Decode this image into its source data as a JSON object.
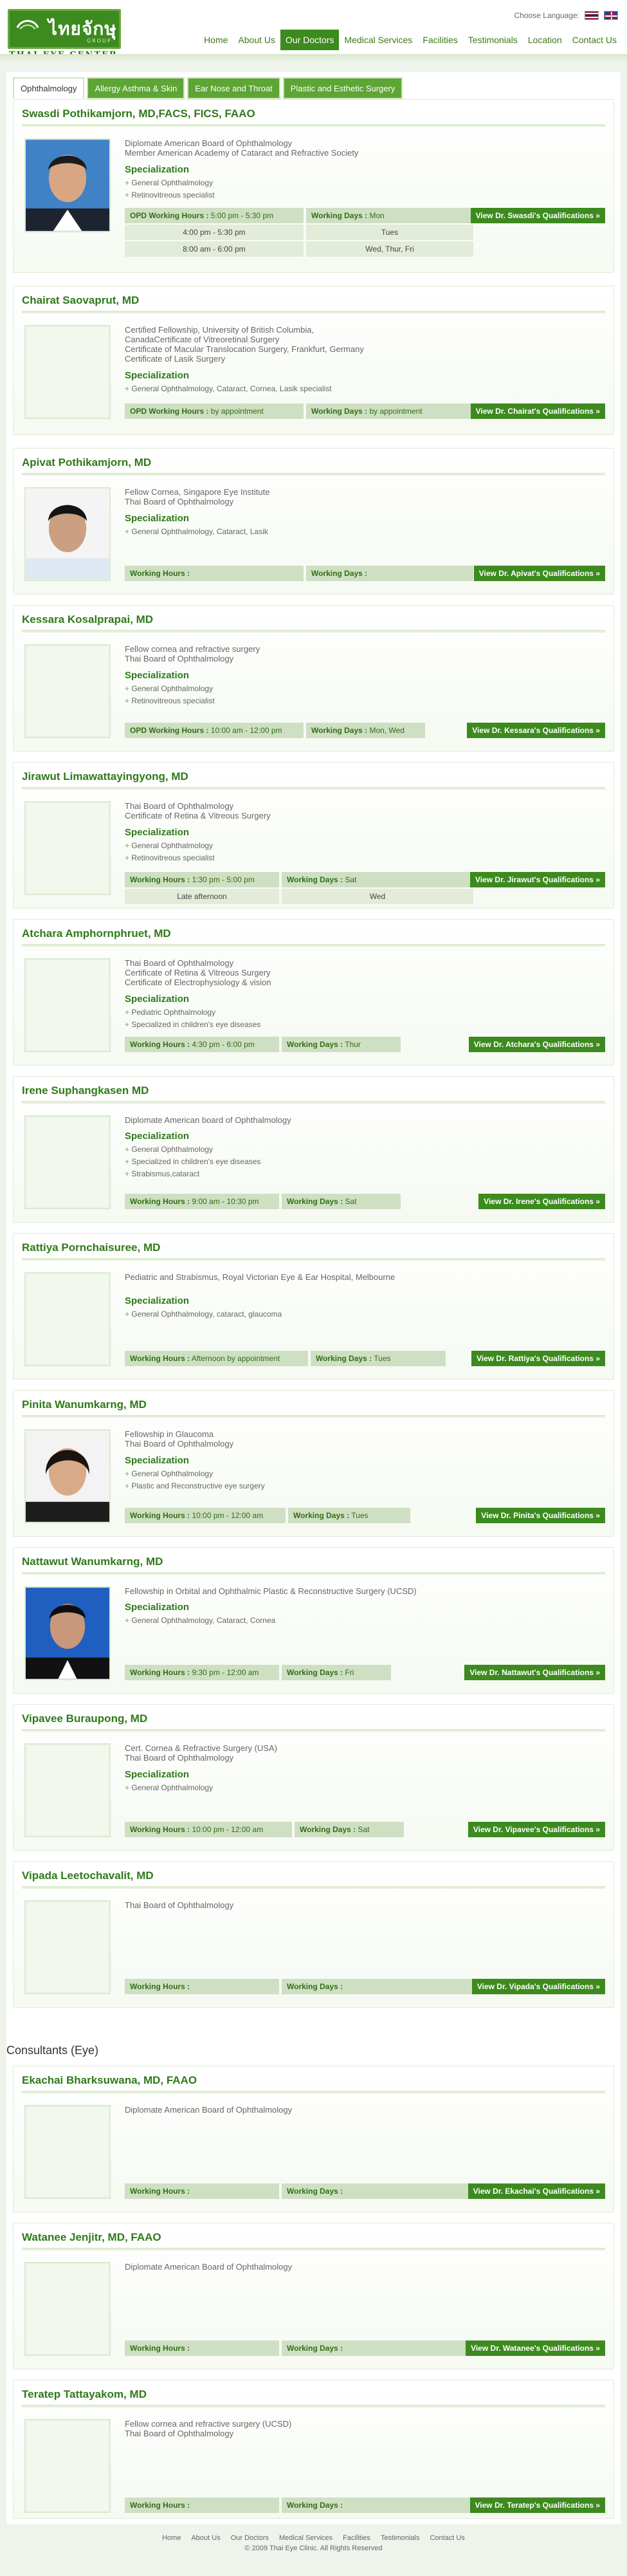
{
  "header": {
    "logo_text": "ไทยจักษุ",
    "logo_sub": "GROUP",
    "logo_caption": "THAI EYE CENTER",
    "choose_language": "Choose Language:",
    "nav": [
      "Home",
      "About Us",
      "Our Doctors",
      "Medical Services",
      "Facilities",
      "Testimonials",
      "Location",
      "Contact Us"
    ]
  },
  "tabs": [
    "Ophthalmology",
    "Allergy Asthma & Skin",
    "Ear Nose and Throat",
    "Plastic and Esthetic Surgery"
  ],
  "doctors": [
    {
      "name": "Swasdi Pothikamjorn, MD,FACS, FICS, FAAO",
      "credentials": [
        "Diplomate American Board of Ophthalmology",
        "Member American Academy of Cataract and Refractive Society"
      ],
      "specialization_label": "Specialization",
      "specializations": [
        "General Ophthalmology",
        "Retinovitreous specialist"
      ],
      "hours_label": "OPD Working Hours :",
      "hours": [
        "5:00 pm - 5:30 pm",
        "4:00 pm - 5:30 pm",
        "8:00 am - 6:00 pm"
      ],
      "days_label": "Working Days :",
      "days": [
        "Mon",
        "Tues",
        "Wed, Thur, Fri"
      ],
      "button": "View Dr. Swasdi's Qualifications »"
    },
    {
      "name": "Chairat Saovaprut, MD",
      "credentials": [
        "Certified Fellowship, University of British Columbia,",
        "CanadaCertificate of Vitreoretinal Surgery",
        "Certificate of Macular Translocation Surgery, Frankfurt, Germany",
        "Certificate of Lasik Surgery"
      ],
      "specialization_label": "Specialization",
      "specializations": [
        "General Ophthalmology, Cataract,  Cornea,  Lasik specialist"
      ],
      "hours_label": "OPD Working Hours :",
      "hours": [
        "by appointment"
      ],
      "days_label": "Working Days :",
      "days": [
        "by appointment"
      ],
      "button": "View Dr. Chairat's Qualifications »"
    },
    {
      "name": "Apivat Pothikamjorn, MD",
      "credentials": [
        "Fellow Cornea, Singapore Eye Institute",
        "Thai Board of Ophthalmology"
      ],
      "specialization_label": "Specialization",
      "specializations": [
        "General Ophthalmology, Cataract,  Lasik"
      ],
      "hours_label": "Working Hours :",
      "hours": [
        ""
      ],
      "days_label": "Working Days :",
      "days": [
        ""
      ],
      "button": "View Dr. Apivat's Qualifications »"
    },
    {
      "name": "Kessara Kosalprapai, MD",
      "credentials": [
        "Fellow cornea and refractive surgery",
        "Thai Board of Ophthalmology"
      ],
      "specialization_label": "Specialization",
      "specializations": [
        "General Ophthalmology",
        "Retinovitreous specialist"
      ],
      "hours_label": "OPD Working Hours :",
      "hours": [
        "10:00 am - 12:00 pm"
      ],
      "days_label": "Working Days :",
      "days": [
        "Mon, Wed"
      ],
      "button": "View Dr. Kessara's Qualifications »"
    },
    {
      "name": "Jirawut Limawattayingyong, MD",
      "credentials": [
        "Thai Board of Ophthalmology",
        "Certificate of Retina & Vitreous Surgery"
      ],
      "specialization_label": "Specialization",
      "specializations": [
        "General Ophthalmology",
        "Retinovitreous specialist"
      ],
      "hours_label": "Working Hours :",
      "hours": [
        "1:30 pm - 5:00 pm",
        "Late afternoon"
      ],
      "days_label": "Working Days :",
      "days": [
        "Sat",
        "Wed"
      ],
      "button": "View Dr. Jirawut's Qualifications »"
    },
    {
      "name": "Atchara Amphornphruet, MD",
      "credentials": [
        "Thai Board of Ophthalmology",
        "Certificate of Retina & Vitreous Surgery",
        "Certificate of Electrophysiology & vision"
      ],
      "specialization_label": "Specialization",
      "specializations": [
        "Pediatric  Ophthalmology",
        "Specialized in children's eye diseases"
      ],
      "hours_label": "Working Hours :",
      "hours": [
        "4:30 pm - 6:00 pm"
      ],
      "days_label": "Working Days :",
      "days": [
        "Thur"
      ],
      "button": "View Dr. Atchara's Qualifications »"
    },
    {
      "name": "Irene Suphangkasen MD",
      "credentials": [
        "Diplomate American board of Ophthalmology"
      ],
      "specialization_label": "Specialization",
      "specializations": [
        "General  Ophthalmology",
        "Specialized in children's eye diseases",
        "Strabismus,cataract"
      ],
      "hours_label": "Working Hours :",
      "hours": [
        "9:00 am - 10:30 pm"
      ],
      "days_label": "Working Days :",
      "days": [
        "Sat"
      ],
      "button": "View Dr. Irene's Qualifications »"
    },
    {
      "name": "Rattiya Pornchaisuree, MD",
      "credentials": [
        "Pediatric and Strabismus, Royal Victorian Eye & Ear Hospital, Melbourne"
      ],
      "specialization_label": "Specialization",
      "specializations": [
        "General Ophthalmology, cataract, glaucoma"
      ],
      "hours_label": "Working Hours :",
      "hours": [
        "Afternoon by appointment"
      ],
      "days_label": "Working Days :",
      "days": [
        "Tues"
      ],
      "button": "View Dr. Rattiya's Qualifications »"
    },
    {
      "name": "Pinita Wanumkarng, MD",
      "credentials": [
        "Fellowship in Glaucoma",
        "Thai Board of Ophthalmology"
      ],
      "specialization_label": "Specialization",
      "specializations": [
        "General Ophthalmology",
        "Plastic and Reconstructive eye surgery"
      ],
      "hours_label": "Working Hours :",
      "hours": [
        "10:00 pm - 12:00 am"
      ],
      "days_label": "Working Days :",
      "days": [
        "Tues"
      ],
      "button": "View Dr. Pinita's Qualifications »"
    },
    {
      "name": "Nattawut Wanumkarng, MD",
      "credentials": [
        "Fellowship in Orbital and Ophthalmic Plastic & Reconstructive Surgery (UCSD)"
      ],
      "specialization_label": "Specialization",
      "specializations": [
        "General Ophthalmology, Cataract,  Cornea"
      ],
      "hours_label": "Working Hours :",
      "hours": [
        "9:30 pm - 12:00 am"
      ],
      "days_label": "Working Days :",
      "days": [
        "Fri"
      ],
      "button": "View Dr. Nattawut's Qualifications »"
    },
    {
      "name": "Vipavee Buraupong, MD",
      "credentials": [
        "Cert. Cornea & Refractive Surgery (USA)",
        "Thai Board of Ophthalmology"
      ],
      "specialization_label": "Specialization",
      "specializations": [
        "General Ophthalmology"
      ],
      "hours_label": "Working Hours :",
      "hours": [
        "10:00 pm - 12:00 am"
      ],
      "days_label": "Working Days :",
      "days": [
        "Sat"
      ],
      "button": "View Dr. Vipavee's Qualifications »"
    },
    {
      "name": "Vipada Leetochavalit, MD",
      "credentials": [
        "Thai Board of Ophthalmology"
      ],
      "specialization_label": "",
      "specializations": [],
      "hours_label": "Working Hours :",
      "hours": [
        ""
      ],
      "days_label": "Working Days :",
      "days": [
        ""
      ],
      "button": "View Dr. Vipada's Qualifications »"
    }
  ],
  "consultants_title": "Consultants (Eye)",
  "consultants": [
    {
      "name": "Ekachai Bharksuwana, MD, FAAO",
      "credentials": [
        "Diplomate American Board of Ophthalmology"
      ],
      "hours_label": "Working Hours :",
      "days_label": "Working Days :",
      "button": "View Dr. Ekachai's Qualifications »"
    },
    {
      "name": "Watanee Jenjitr, MD, FAAO",
      "credentials": [
        "Diplomate American Board of Ophthalmology"
      ],
      "hours_label": "Working Hours :",
      "days_label": "Working Days :",
      "button": "View Dr. Watanee's Qualifications »"
    },
    {
      "name": "Teratep Tattayakom, MD",
      "credentials": [
        "Fellow cornea and refractive surgery (UCSD)",
        "Thai Board of Ophthalmology"
      ],
      "hours_label": "Working Hours :",
      "days_label": "Working Days :",
      "button": "View Dr. Teratep's Qualifications »"
    }
  ],
  "footer": {
    "links": [
      "Home",
      "About Us",
      "Our Doctors",
      "Medical Services",
      "Facilities",
      "Testimonials",
      "Contact Us"
    ],
    "copyright": "© 2009 Thai Eye Clinic. All Rights Reserved"
  }
}
